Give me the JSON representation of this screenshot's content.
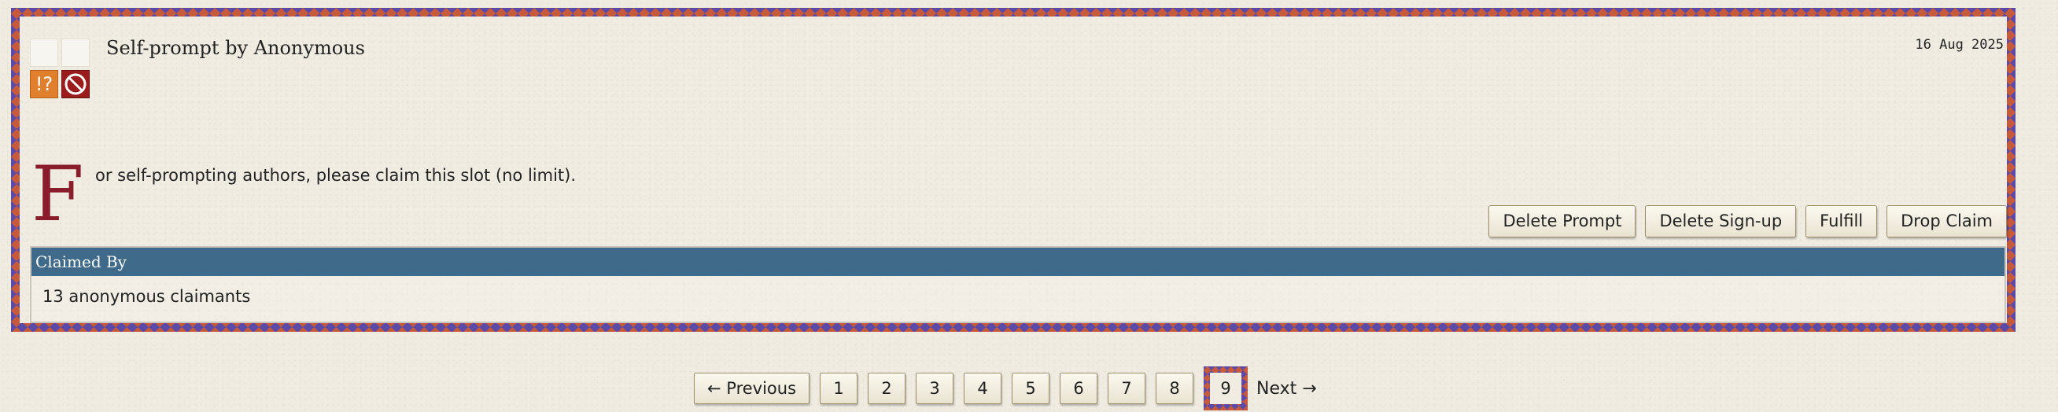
{
  "blurb": {
    "heading": "Self-prompt by Anonymous",
    "date": "16 Aug 2025",
    "icons": [
      "blank-icon",
      "blank-icon",
      "warning-icon",
      "prohibited-icon"
    ],
    "warning_glyph": "!?",
    "summary": {
      "dropcap": "F",
      "text": "or self-prompting authors, please claim this slot (no limit)."
    },
    "actions": {
      "delete_prompt": "Delete Prompt",
      "delete_signup": "Delete Sign-up",
      "fulfill": "Fulfill",
      "drop_claim": "Drop Claim"
    },
    "claims": {
      "header": "Claimed By",
      "body": "13 anonymous claimants"
    }
  },
  "pagination": {
    "previous": "← Previous",
    "pages": [
      "1",
      "2",
      "3",
      "4",
      "5",
      "6",
      "7",
      "8"
    ],
    "current": "9",
    "next": "Next →"
  },
  "colors": {
    "border_orange": "#c65a3a",
    "border_purple": "#5b4aa8",
    "claims_header": "#3f6a8a",
    "dropcap": "#8a1d2c",
    "warning_icon": "#e0802e",
    "prohibited_icon": "#9b1c1c"
  }
}
